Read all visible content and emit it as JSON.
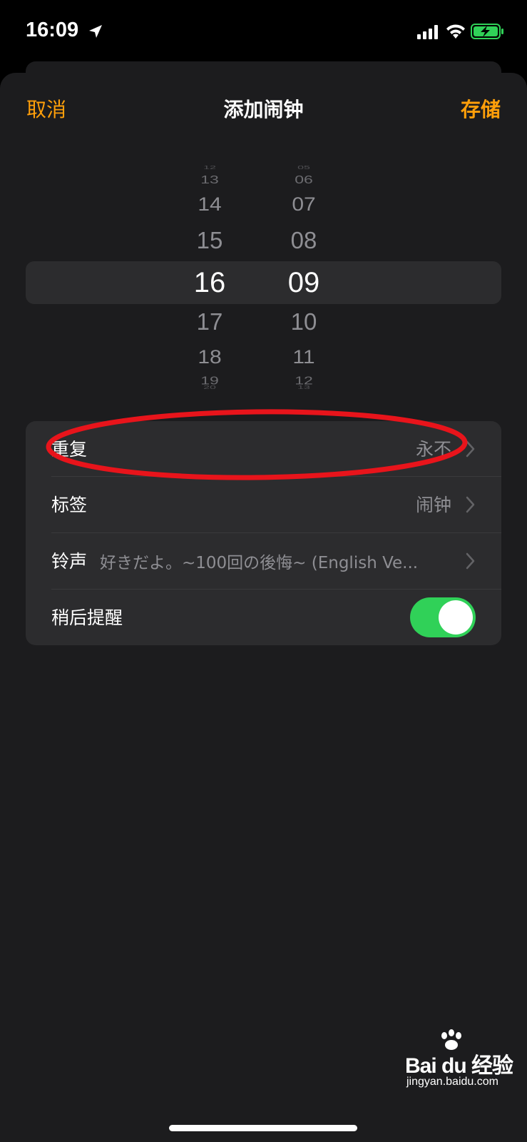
{
  "status_bar": {
    "time": "16:09",
    "icons": [
      "location-arrow-icon",
      "cellular-signal-icon",
      "wifi-icon",
      "battery-charging-icon"
    ]
  },
  "nav": {
    "cancel_label": "取消",
    "title": "添加闹钟",
    "save_label": "存储"
  },
  "picker": {
    "hours": {
      "above": [
        "12",
        "13",
        "14",
        "15"
      ],
      "selected": "16",
      "below": [
        "17",
        "18",
        "19",
        "20"
      ]
    },
    "minutes": {
      "above": [
        "05",
        "06",
        "07",
        "08"
      ],
      "selected": "09",
      "below": [
        "10",
        "11",
        "12",
        "13"
      ]
    }
  },
  "settings": {
    "repeat": {
      "label": "重复",
      "value": "永不"
    },
    "label": {
      "label": "标签",
      "value": "闹钟"
    },
    "sound": {
      "label": "铃声",
      "value": "好きだよ。~100回の後悔~ (English Ve..."
    },
    "snooze": {
      "label": "稍后提醒",
      "enabled": true
    }
  },
  "colors": {
    "accent": "#ff9f0a",
    "toggle_on": "#30d158",
    "annotation": "#e8141b",
    "sheet_bg": "#1c1c1e",
    "card_bg": "#2c2c2e"
  },
  "watermark": {
    "brand": "Bai du 经验",
    "url": "jingyan.baidu.com"
  }
}
